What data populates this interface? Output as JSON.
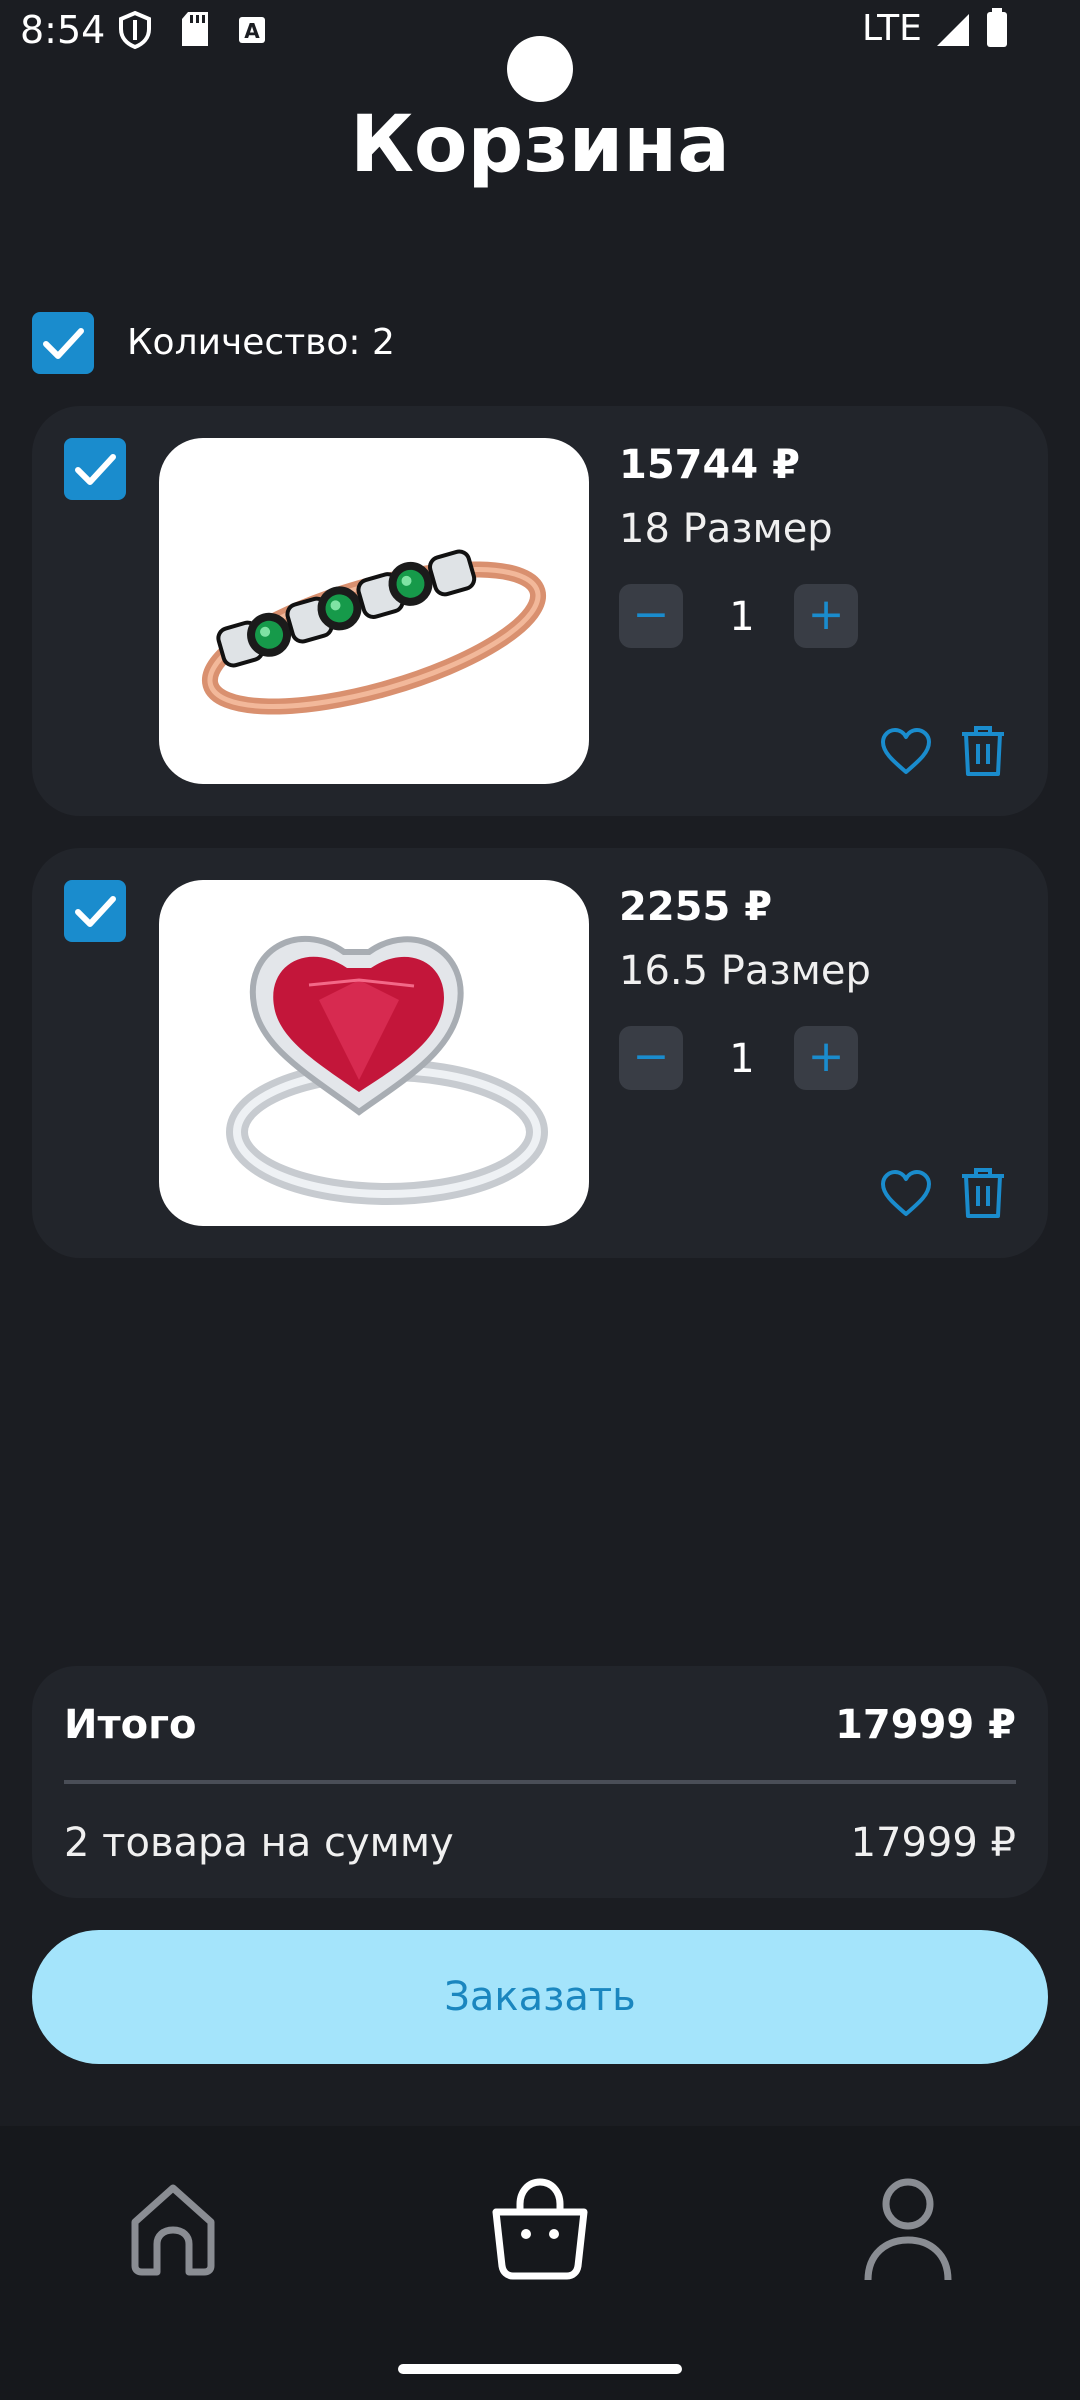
{
  "status_bar": {
    "time": "8:54",
    "network": "LTE",
    "icons": [
      "shield-icon",
      "sd-card-icon",
      "keyboard-a-icon",
      "signal-icon",
      "battery-icon"
    ]
  },
  "page": {
    "title": "Корзина"
  },
  "select_all": {
    "checked": true,
    "label": "Количество: 2"
  },
  "items": [
    {
      "checked": true,
      "image": "ring-rose-gold-emerald",
      "price": "15744 ₽",
      "size": "18 Размер",
      "quantity": "1",
      "decrement": "−",
      "increment": "+"
    },
    {
      "checked": true,
      "image": "ring-silver-ruby-heart",
      "price": "2255 ₽",
      "size": "16.5 Размер",
      "quantity": "1",
      "decrement": "−",
      "increment": "+"
    }
  ],
  "summary": {
    "total_label": "Итого",
    "total_value": "17999 ₽",
    "count_label": "2 товара на сумму",
    "count_value": "17999 ₽"
  },
  "order_button": {
    "label": "Заказать"
  },
  "bottom_nav": {
    "items": [
      {
        "icon": "home-icon",
        "active": false
      },
      {
        "icon": "shopping-bag-icon",
        "active": true
      },
      {
        "icon": "profile-icon",
        "active": false
      }
    ]
  },
  "colors": {
    "background": "#1b1d22",
    "card": "#22252b",
    "accent": "#1a8ccd",
    "order_button": "#a4e4fb",
    "order_text": "#1a86bf"
  }
}
